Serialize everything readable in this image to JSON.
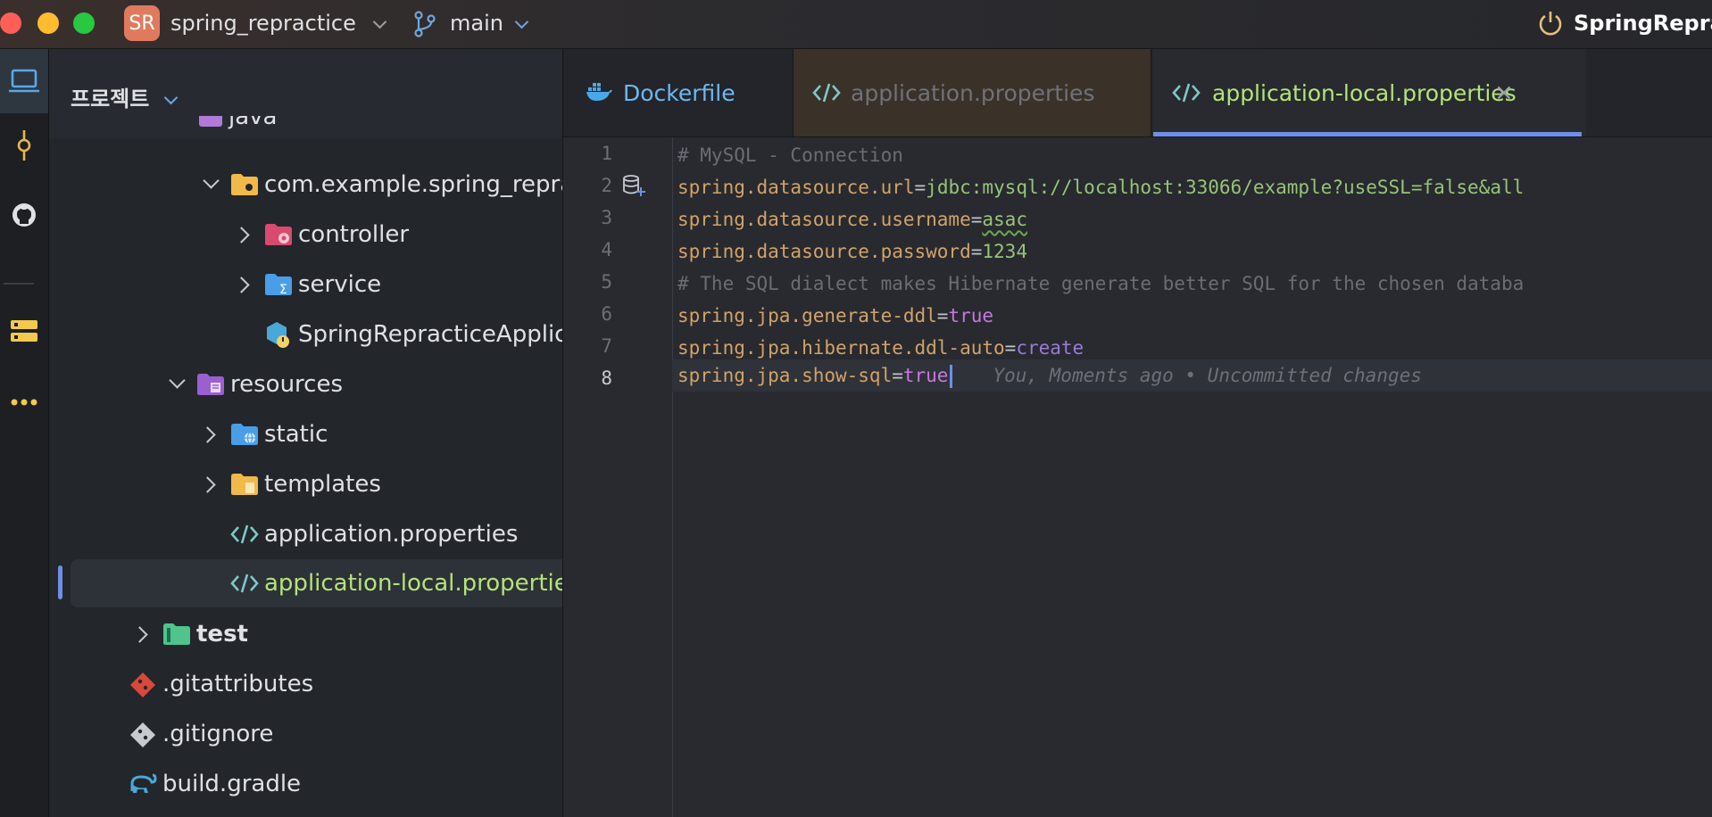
{
  "titlebar": {
    "project_initials": "SR",
    "project_name": "spring_repractice",
    "branch": "main",
    "run_config": "SpringRepra"
  },
  "sidebar": {
    "title": "프로젝트",
    "items": [
      {
        "label": "java"
      },
      {
        "label": "com.example.spring_repra"
      },
      {
        "label": "controller"
      },
      {
        "label": "service"
      },
      {
        "label": "SpringRepracticeApplica"
      },
      {
        "label": "resources"
      },
      {
        "label": "static"
      },
      {
        "label": "templates"
      },
      {
        "label": "application.properties"
      },
      {
        "label": "application-local.propertie"
      },
      {
        "label": "test"
      },
      {
        "label": ".gitattributes"
      },
      {
        "label": ".gitignore"
      },
      {
        "label": "build.gradle"
      }
    ]
  },
  "tabs": [
    {
      "label": "Dockerfile"
    },
    {
      "label": "application.properties"
    },
    {
      "label": "application-local.properties",
      "close": "×"
    }
  ],
  "editor": {
    "line_numbers": [
      "1",
      "2",
      "3",
      "4",
      "5",
      "6",
      "7",
      "8"
    ],
    "lines": [
      {
        "text": "# MySQL - Connection"
      },
      {
        "key": "spring.datasource.url",
        "eq": "=",
        "value": "jdbc:mysql://localhost:33066/example?useSSL=false&all"
      },
      {
        "key": "spring.datasource.username",
        "eq": "=",
        "value": "asac"
      },
      {
        "key": "spring.datasource.password",
        "eq": "=",
        "value": "1234"
      },
      {
        "text": "# The SQL dialect makes Hibernate generate better SQL for the chosen databa"
      },
      {
        "key": "spring.jpa.generate-ddl",
        "eq": "=",
        "value": "true"
      },
      {
        "key": "spring.jpa.hibernate.ddl-auto",
        "eq": "=",
        "value": "create"
      },
      {
        "key": "spring.jpa.show-sql",
        "eq": "=",
        "value": "true"
      }
    ],
    "blame": "You, Moments ago • Uncommitted changes"
  },
  "colors": {
    "accent": "#6e8fe8",
    "green_text": "#b4e37a",
    "comment": "#6a6d74"
  }
}
